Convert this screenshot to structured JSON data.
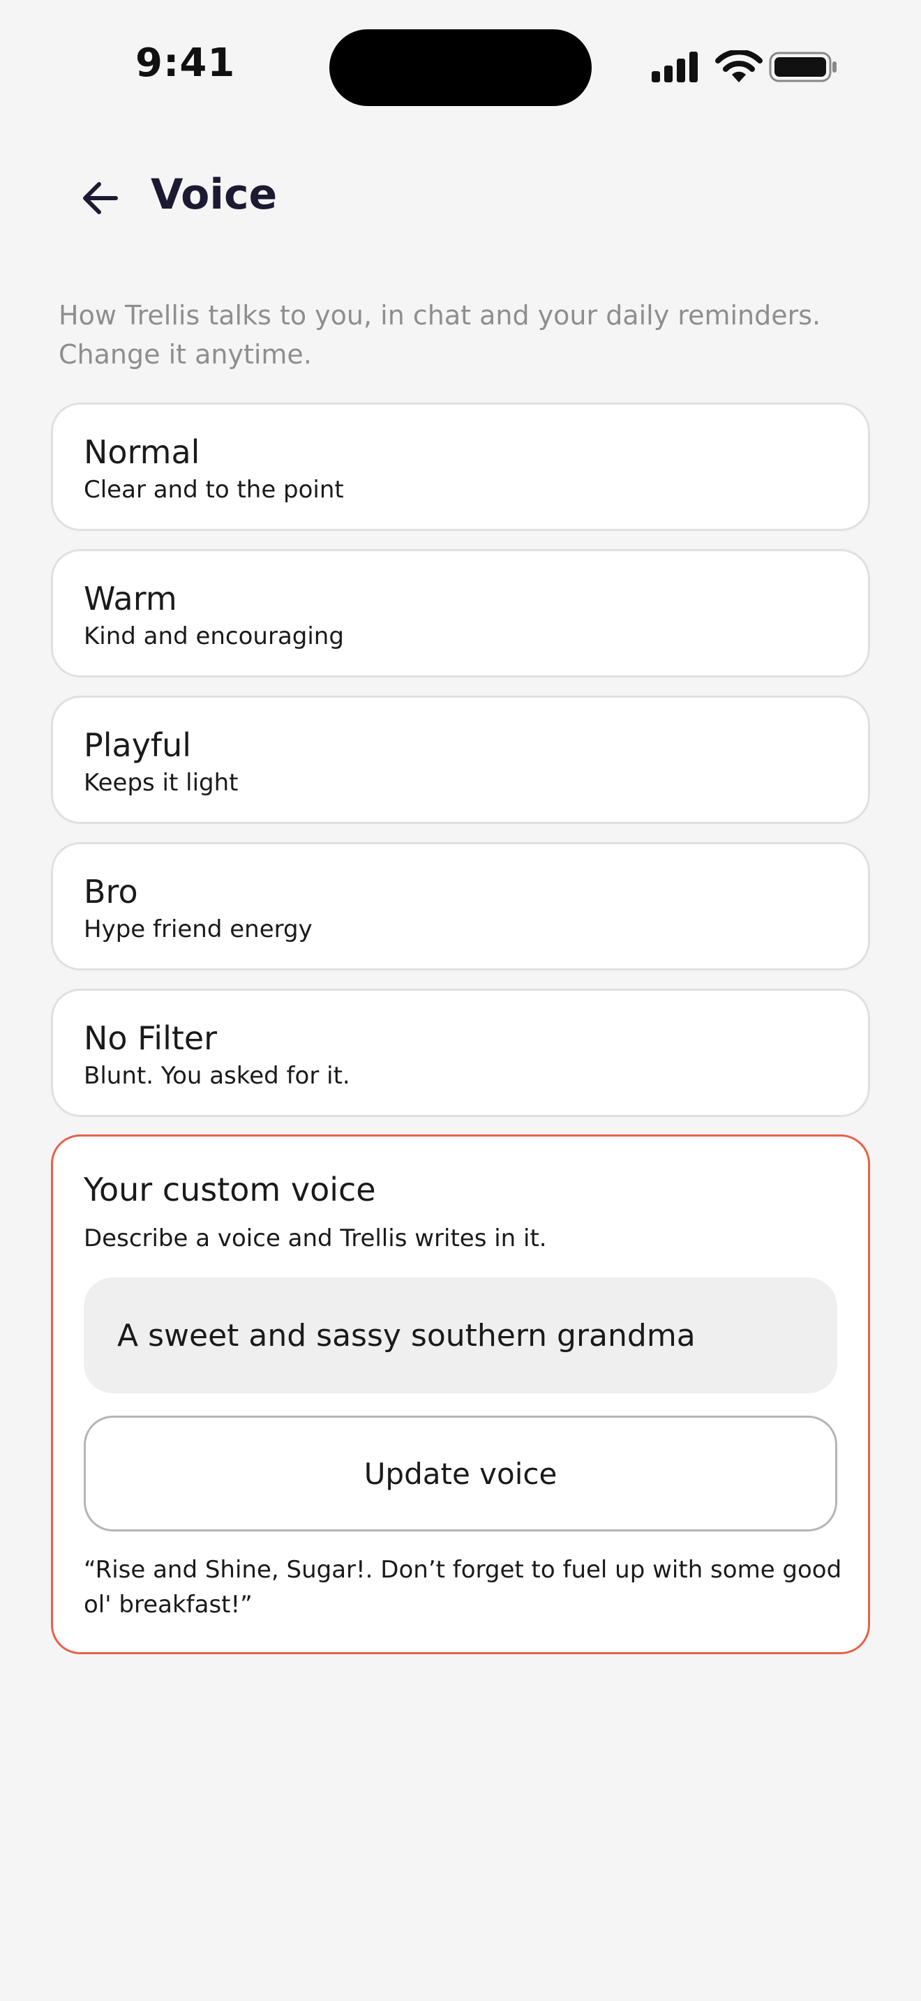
{
  "status_bar": {
    "time": "9:41",
    "icons": [
      "signal-icon",
      "wifi-icon",
      "battery-icon"
    ]
  },
  "header": {
    "back_icon": "arrow-left-icon",
    "title": "Voice"
  },
  "subtitle": "How Trellis talks to you, in chat and your daily reminders. Change it anytime.",
  "options": [
    {
      "title": "Normal",
      "description": "Clear and to the point"
    },
    {
      "title": "Warm",
      "description": "Kind and encouraging"
    },
    {
      "title": "Playful",
      "description": "Keeps it light"
    },
    {
      "title": "Bro",
      "description": "Hype friend energy"
    },
    {
      "title": "No Filter",
      "description": "Blunt. You asked for it."
    }
  ],
  "custom_voice": {
    "title": "Your custom voice",
    "description": "Describe a voice and Trellis writes in it.",
    "input_value": "A sweet and sassy southern grandma",
    "button_label": "Update voice",
    "preview": "“Rise and Shine, Sugar!. Don’t forget to fuel up with some good ol' breakfast!”"
  },
  "colors": {
    "background": "#f5f5f5",
    "selected_border": "#e8604a",
    "card_border": "#e0e0e0",
    "title": "#1c1a33",
    "muted_text": "#8e8e8e"
  }
}
